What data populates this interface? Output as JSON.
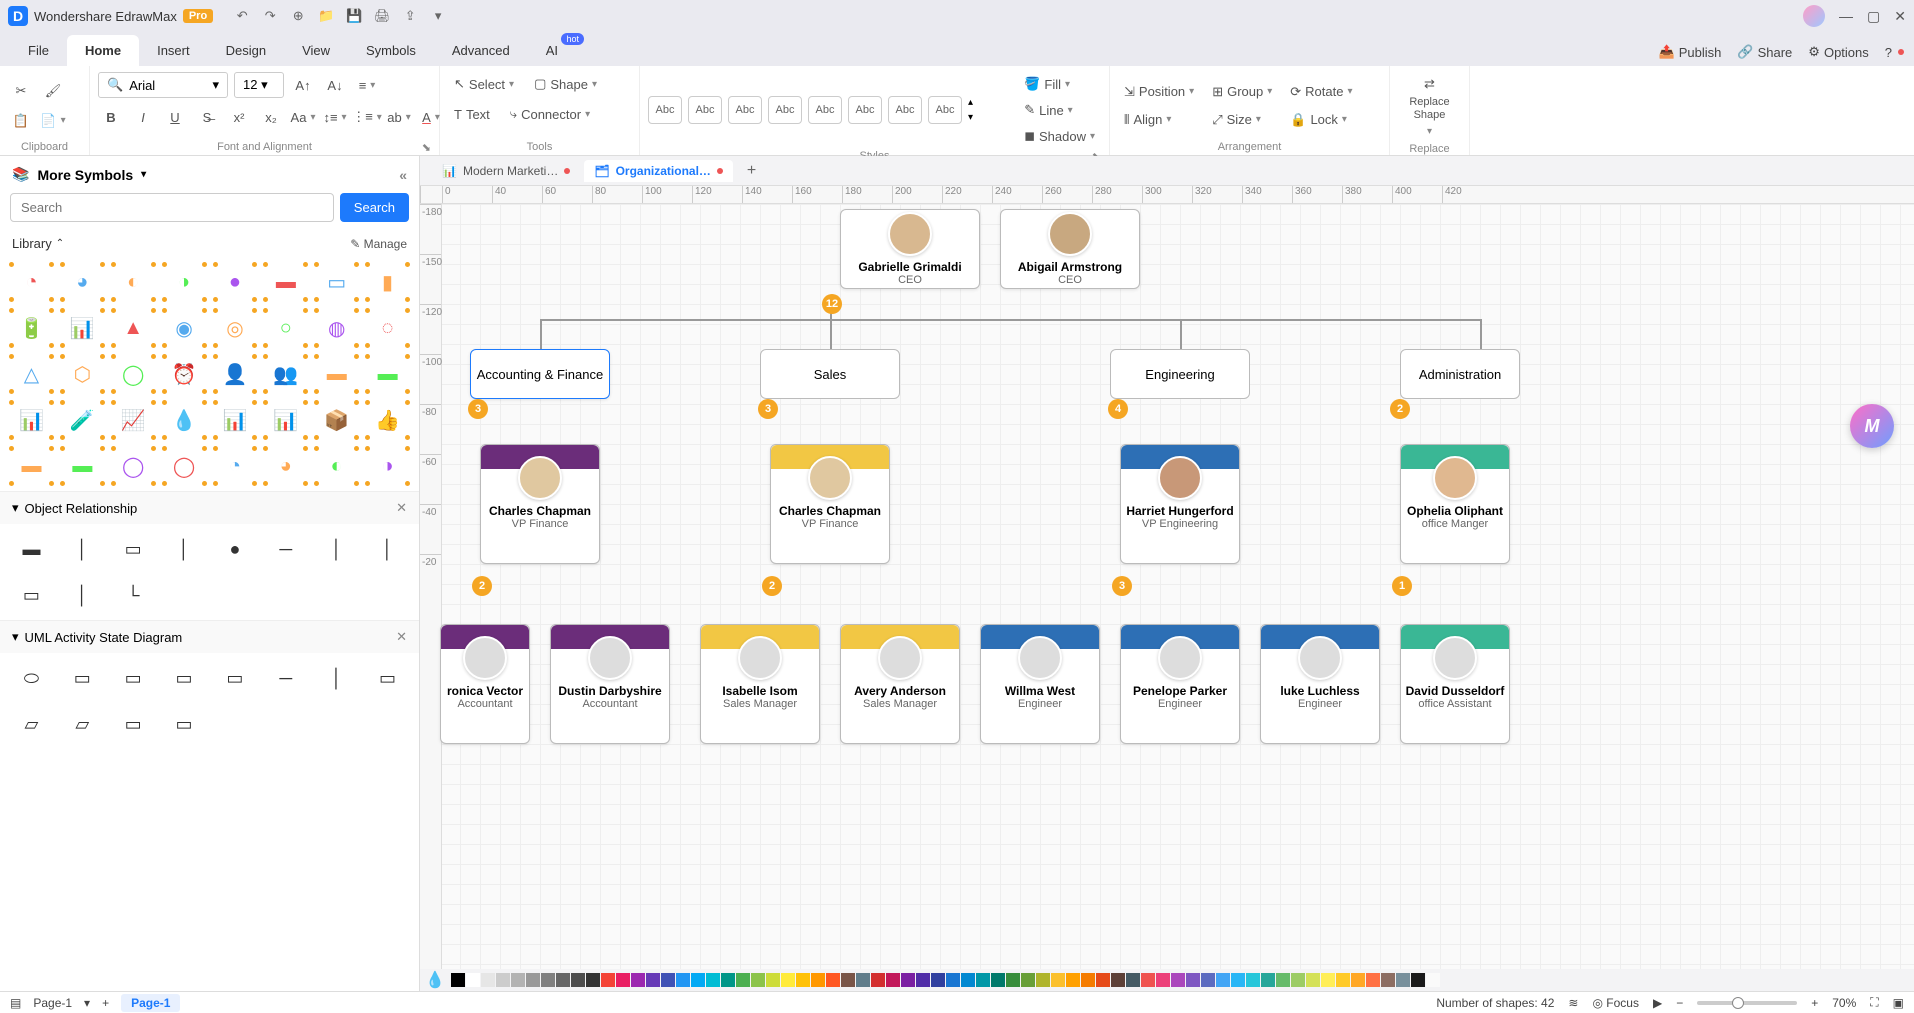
{
  "app": {
    "name": "Wondershare EdrawMax",
    "badge": "Pro"
  },
  "menubar": {
    "items": [
      "File",
      "Home",
      "Insert",
      "Design",
      "View",
      "Symbols",
      "Advanced",
      "AI"
    ],
    "active": "Home",
    "ai_badge": "hot",
    "right": {
      "publish": "Publish",
      "share": "Share",
      "options": "Options"
    }
  },
  "ribbon": {
    "font_family": "Arial",
    "font_size": "12",
    "select": "Select",
    "shape": "Shape",
    "text": "Text",
    "connector": "Connector",
    "style_swatch": "Abc",
    "fill": "Fill",
    "line": "Line",
    "shadow": "Shadow",
    "position": "Position",
    "align": "Align",
    "group": "Group",
    "size": "Size",
    "rotate": "Rotate",
    "lock": "Lock",
    "replace_shape": "Replace Shape",
    "groups": {
      "clipboard": "Clipboard",
      "font": "Font and Alignment",
      "tools": "Tools",
      "styles": "Styles",
      "arrangement": "Arrangement",
      "replace": "Replace"
    }
  },
  "leftpanel": {
    "title": "More Symbols",
    "search_placeholder": "Search",
    "search_btn": "Search",
    "library": "Library",
    "manage": "Manage",
    "sections": {
      "obj_rel": "Object Relationship",
      "uml": "UML Activity State Diagram"
    }
  },
  "tabs": {
    "t1": "Modern Marketi…",
    "t2": "Organizational…"
  },
  "ruler_h": [
    "0",
    "40",
    "60",
    "80",
    "100",
    "120",
    "140",
    "160",
    "180",
    "200",
    "220",
    "240",
    "260",
    "280",
    "300",
    "320",
    "340",
    "360",
    "380",
    "400",
    "420"
  ],
  "ruler_v": [
    "-180",
    "-150",
    "-120",
    "-100",
    "-80",
    "-60",
    "-40",
    "-20"
  ],
  "org": {
    "ceo1": {
      "name": "Gabrielle Grimaldi",
      "title": "CEO"
    },
    "ceo2": {
      "name": "Abigail Armstrong",
      "title": "CEO"
    },
    "dept1": "Accounting & Finance",
    "dept2": "Sales",
    "dept3": "Engineering",
    "dept4": "Administration",
    "vp1": {
      "name": "Charles Chapman",
      "title": "VP Finance"
    },
    "vp2": {
      "name": "Charles Chapman",
      "title": "VP Finance"
    },
    "vp3": {
      "name": "Harriet Hungerford",
      "title": "VP Engineering"
    },
    "vp4": {
      "name": "Ophelia Oliphant",
      "title": "office Manger"
    },
    "e1": {
      "name": "ronica Vector",
      "title": "Accountant"
    },
    "e2": {
      "name": "Dustin Darbyshire",
      "title": "Accountant"
    },
    "e3": {
      "name": "Isabelle Isom",
      "title": "Sales Manager"
    },
    "e4": {
      "name": "Avery Anderson",
      "title": "Sales Manager"
    },
    "e5": {
      "name": "Willma West",
      "title": "Engineer"
    },
    "e6": {
      "name": "Penelope Parker",
      "title": "Engineer"
    },
    "e7": {
      "name": "luke Luchless",
      "title": "Engineer"
    },
    "e8": {
      "name": "David Dusseldorf",
      "title": "office Assistant"
    },
    "badges": {
      "top": "12",
      "d1": "3",
      "d2": "3",
      "d3": "4",
      "d4": "2",
      "v1": "2",
      "v2": "2",
      "v3": "3",
      "v4": "1"
    }
  },
  "palette_colors": [
    "#000",
    "#fff",
    "#e6e6e6",
    "#ccc",
    "#b3b3b3",
    "#999",
    "#808080",
    "#666",
    "#4d4d4d",
    "#333",
    "#f44336",
    "#e91e63",
    "#9c27b0",
    "#673ab7",
    "#3f51b5",
    "#2196f3",
    "#03a9f4",
    "#00bcd4",
    "#009688",
    "#4caf50",
    "#8bc34a",
    "#cddc39",
    "#ffeb3b",
    "#ffc107",
    "#ff9800",
    "#ff5722",
    "#795548",
    "#607d8b",
    "#d32f2f",
    "#c2185b",
    "#7b1fa2",
    "#512da8",
    "#303f9f",
    "#1976d2",
    "#0288d1",
    "#0097a7",
    "#00796b",
    "#388e3c",
    "#689f38",
    "#afb42b",
    "#fbc02d",
    "#ffa000",
    "#f57c00",
    "#e64a19",
    "#5d4037",
    "#455a64",
    "#ef5350",
    "#ec407a",
    "#ab47bc",
    "#7e57c2",
    "#5c6bc0",
    "#42a5f5",
    "#29b6f6",
    "#26c6da",
    "#26a69a",
    "#66bb6a",
    "#9ccc65",
    "#d4e157",
    "#ffee58",
    "#ffca28",
    "#ffa726",
    "#ff7043",
    "#8d6e63",
    "#78909c",
    "#1a1a1a",
    "#fafafa"
  ],
  "status": {
    "page_name": "Page-1",
    "pagetab": "Page-1",
    "shapes": "Number of shapes: 42",
    "focus": "Focus",
    "zoom": "70%"
  }
}
